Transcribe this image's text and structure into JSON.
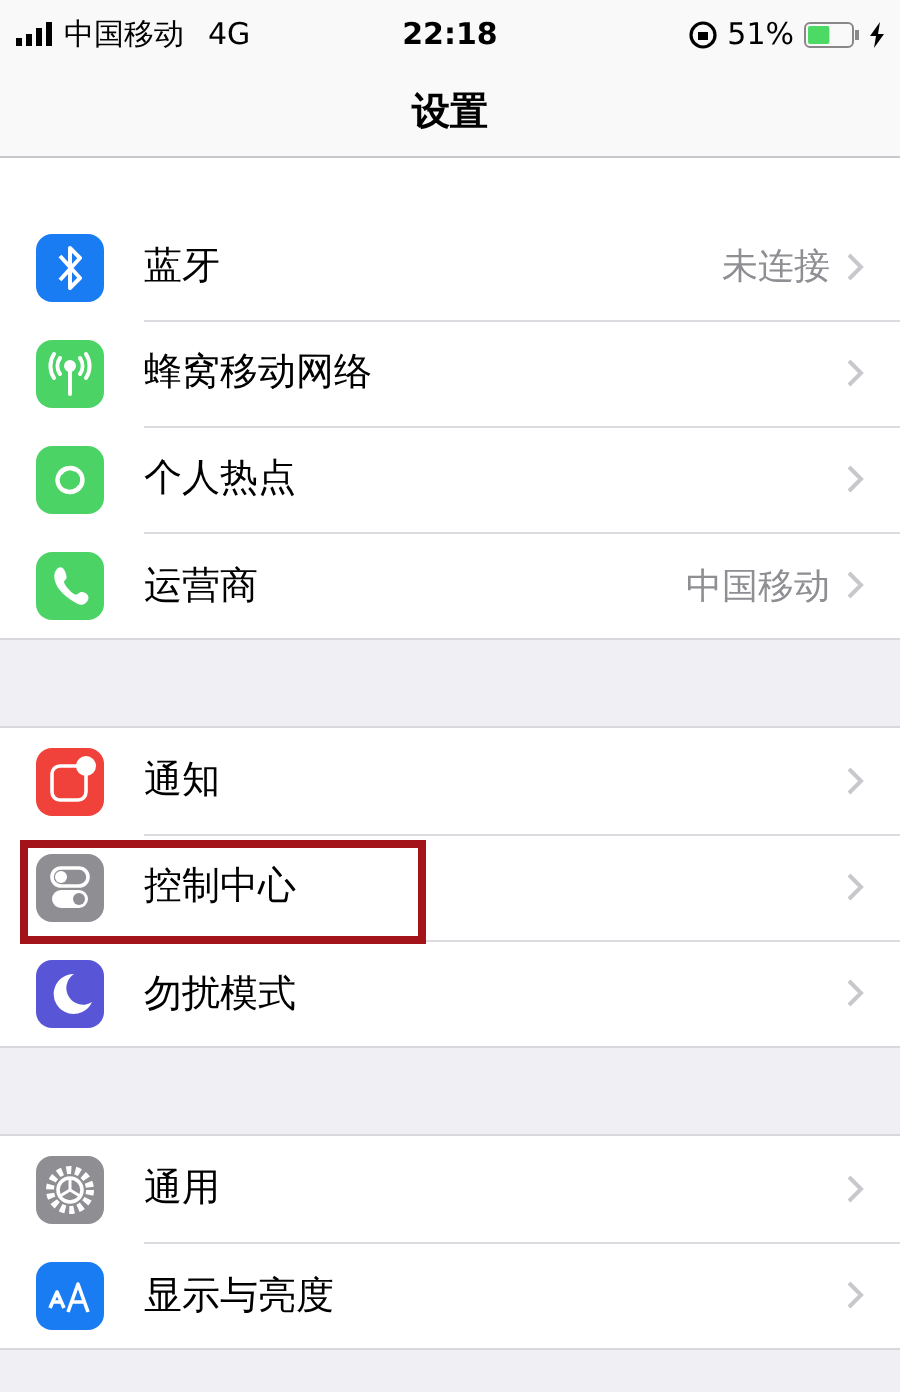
{
  "status_bar": {
    "carrier": "中国移动",
    "network": "4G",
    "time": "22:18",
    "battery_text": "51%",
    "battery": {
      "level": 0.51
    },
    "charging": true,
    "rotation_lock": true
  },
  "nav_bar": {
    "title": "设置"
  },
  "groups": [
    {
      "items": [
        {
          "kind": "bluetooth",
          "color": "#1a7cf2",
          "label": "蓝牙",
          "value": "未连接",
          "highlighted": false
        },
        {
          "kind": "antenna",
          "color": "#4cd365",
          "label": "蜂窝移动网络",
          "highlighted": false
        },
        {
          "kind": "hotspot",
          "color": "#4cd365",
          "label": "个人热点",
          "highlighted": false
        },
        {
          "kind": "phone",
          "color": "#4cd365",
          "label": "运营商",
          "value": "中国移动",
          "highlighted": false
        }
      ]
    },
    {
      "items": [
        {
          "kind": "notification",
          "color": "#f0413a",
          "label": "通知",
          "highlighted": false
        },
        {
          "kind": "switches",
          "color": "#8e8e93",
          "label": "控制中心",
          "highlighted": true
        },
        {
          "kind": "moon",
          "color": "#5856d6",
          "label": "勿扰模式",
          "highlighted": false
        }
      ]
    },
    {
      "items": [
        {
          "kind": "gear",
          "color": "#8e8e93",
          "label": "通用",
          "highlighted": false
        },
        {
          "kind": "textsize",
          "color": "#1a7cf2",
          "label": "显示与亮度",
          "highlighted": false
        }
      ]
    }
  ]
}
